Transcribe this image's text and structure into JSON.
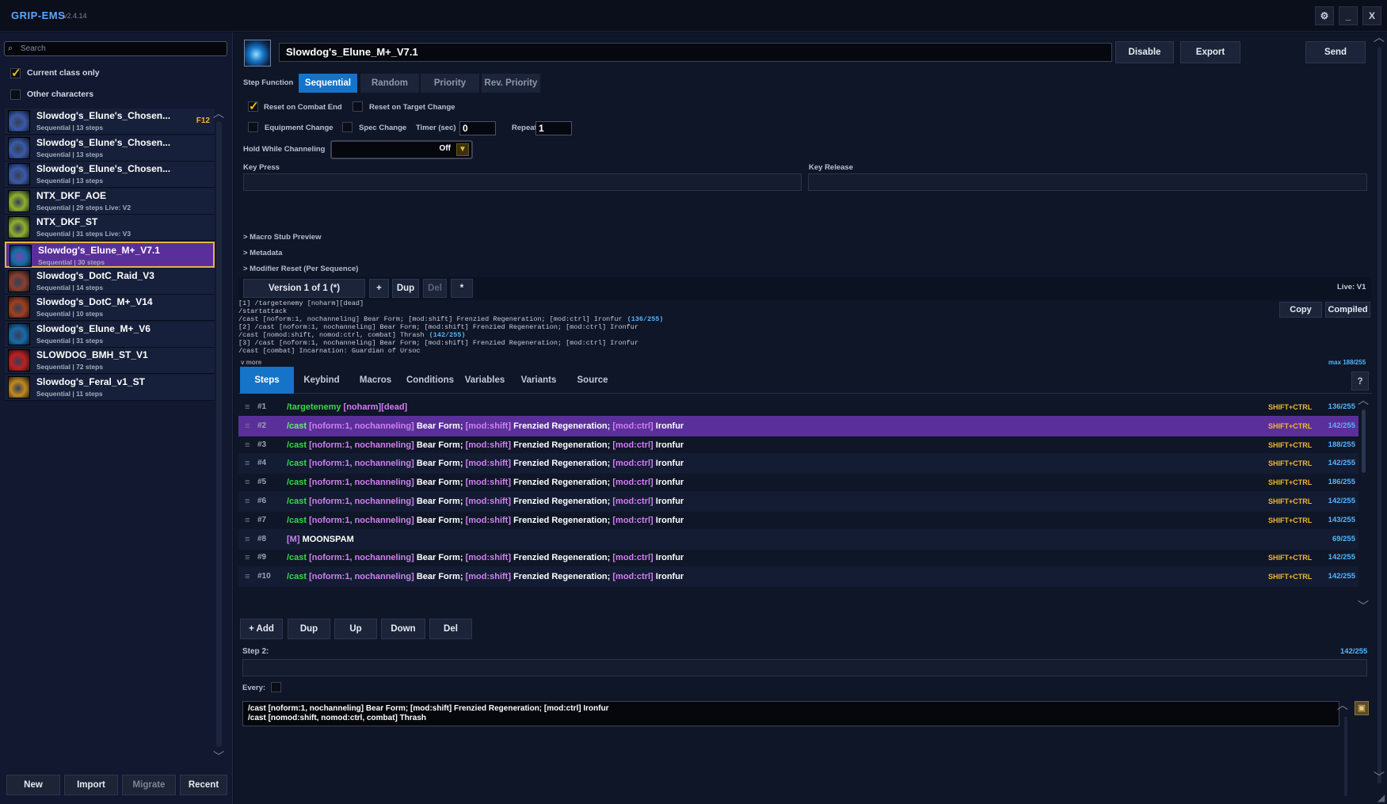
{
  "app": {
    "title": "GRIP-EMS",
    "version": "v2.4.14"
  },
  "window_buttons": {
    "settings_icon": "gear-icon",
    "minimize_label": "_",
    "close_label": "X"
  },
  "sidebar": {
    "search_placeholder": "Search",
    "current_class_only": {
      "label": "Current class only",
      "checked": true
    },
    "other_characters": {
      "label": "Other characters",
      "checked": false
    },
    "sequences": [
      {
        "name": "Slowdog's_Elune's_Chosen...",
        "sub": "Sequential | 13 steps",
        "key": "F12",
        "icon_color": "#3a5aa8",
        "selected": false
      },
      {
        "name": "Slowdog's_Elune's_Chosen...",
        "sub": "Sequential | 13 steps",
        "key": "",
        "icon_color": "#3a5aa8",
        "selected": false
      },
      {
        "name": "Slowdog's_Elune's_Chosen...",
        "sub": "Sequential | 13 steps",
        "key": "",
        "icon_color": "#3a5aa8",
        "selected": false
      },
      {
        "name": "NTX_DKF_AOE",
        "sub": "Sequential | 29 steps   Live: V2",
        "key": "",
        "icon_color": "#8fb030",
        "selected": false
      },
      {
        "name": "NTX_DKF_ST",
        "sub": "Sequential | 31 steps   Live: V3",
        "key": "",
        "icon_color": "#8fb030",
        "selected": false
      },
      {
        "name": "Slowdog's_Elune_M+_V7.1",
        "sub": "Sequential | 30 steps",
        "key": "",
        "icon_color": "#1a6aa8",
        "selected": true
      },
      {
        "name": "Slowdog's_DotC_Raid_V3",
        "sub": "Sequential | 14 steps",
        "key": "",
        "icon_color": "#8a4030",
        "selected": false
      },
      {
        "name": "Slowdog's_DotC_M+_V14",
        "sub": "Sequential | 10 steps",
        "key": "",
        "icon_color": "#a04020",
        "selected": false
      },
      {
        "name": "Slowdog's_Elune_M+_V6",
        "sub": "Sequential | 31 steps",
        "key": "",
        "icon_color": "#1a6aa8",
        "selected": false
      },
      {
        "name": "SLOWDOG_BMH_ST_V1",
        "sub": "Sequential | 72 steps",
        "key": "",
        "icon_color": "#c02020",
        "selected": false
      },
      {
        "name": "Slowdog's_Feral_v1_ST",
        "sub": "Sequential | 11 steps",
        "key": "",
        "icon_color": "#c08a20",
        "selected": false
      }
    ],
    "buttons": {
      "new": "New",
      "import": "Import",
      "migrate": "Migrate",
      "recent": "Recent"
    }
  },
  "editor": {
    "sequence_name": "Slowdog's_Elune_M+_V7.1",
    "disable": "Disable",
    "export": "Export",
    "send": "Send",
    "step_function_label": "Step Function",
    "step_functions": [
      "Sequential",
      "Random",
      "Priority",
      "Rev. Priority"
    ],
    "step_function_selected": "Sequential",
    "reset_on_combat_end": {
      "label": "Reset on Combat End",
      "checked": true
    },
    "reset_on_target_change": {
      "label": "Reset on Target Change",
      "checked": false
    },
    "equipment_change": {
      "label": "Equipment Change",
      "checked": false
    },
    "spec_change": {
      "label": "Spec Change",
      "checked": false
    },
    "timer_label": "Timer (sec)",
    "timer_value": "0",
    "repeat_label": "Repeat",
    "repeat_value": "1",
    "hold_while_channeling_label": "Hold While Channeling",
    "hold_while_channeling_value": "Off",
    "key_press_label": "Key Press",
    "key_release_label": "Key Release",
    "expanders": [
      "> Macro Stub Preview",
      "> Metadata",
      "> Modifier Reset (Per Sequence)"
    ],
    "version_label": "Version 1 of 1 (*)",
    "version_buttons": {
      "add": "+",
      "dup": "Dup",
      "del": "Del",
      "star": "*"
    },
    "live_label": "Live: V1",
    "copy": "Copy",
    "compiled": "Compiled",
    "macro_preview": [
      {
        "text": "[1] /targetenemy [noharm][dead]",
        "len": ""
      },
      {
        "text": "/startattack",
        "len": ""
      },
      {
        "text": "/cast [noform:1, nochanneling] Bear Form; [mod:shift] Frenzied Regeneration; [mod:ctrl] Ironfur",
        "len": "(136/255)"
      },
      {
        "text": "[2] /cast [noform:1, nochanneling] Bear Form; [mod:shift] Frenzied Regeneration; [mod:ctrl] Ironfur",
        "len": ""
      },
      {
        "text": "/cast [nomod:shift, nomod:ctrl, combat] Thrash",
        "len": "(142/255)"
      },
      {
        "text": "[3] /cast [noform:1, nochanneling] Bear Form; [mod:shift] Frenzied Regeneration; [mod:ctrl] Ironfur",
        "len": ""
      },
      {
        "text": "/cast [combat] Incarnation: Guardian of Ursoc",
        "len": ""
      }
    ],
    "more_label": "v more",
    "max_label": "max 188/255",
    "tabs": [
      "Steps",
      "Keybind",
      "Macros",
      "Conditions",
      "Variables",
      "Variants",
      "Source"
    ],
    "tab_selected": "Steps",
    "help": "?",
    "steps": [
      {
        "num": "#1",
        "cmd": "/targetenemy",
        "cond": "[noharm][dead]",
        "rest": [],
        "key": "SHIFT+CTRL",
        "count": "136/255"
      },
      {
        "num": "#2",
        "cmd": "/cast",
        "cond": "[noform:1, nochanneling]",
        "rest": [
          "Bear Form;",
          "[mod:shift]",
          "Frenzied Regeneration;",
          "[mod:ctrl]",
          "Ironfur"
        ],
        "key": "SHIFT+CTRL",
        "count": "142/255"
      },
      {
        "num": "#3",
        "cmd": "/cast",
        "cond": "[noform:1, nochanneling]",
        "rest": [
          "Bear Form;",
          "[mod:shift]",
          "Frenzied Regeneration;",
          "[mod:ctrl]",
          "Ironfur"
        ],
        "key": "SHIFT+CTRL",
        "count": "188/255"
      },
      {
        "num": "#4",
        "cmd": "/cast",
        "cond": "[noform:1, nochanneling]",
        "rest": [
          "Bear Form;",
          "[mod:shift]",
          "Frenzied Regeneration;",
          "[mod:ctrl]",
          "Ironfur"
        ],
        "key": "SHIFT+CTRL",
        "count": "142/255"
      },
      {
        "num": "#5",
        "cmd": "/cast",
        "cond": "[noform:1, nochanneling]",
        "rest": [
          "Bear Form;",
          "[mod:shift]",
          "Frenzied Regeneration;",
          "[mod:ctrl]",
          "Ironfur"
        ],
        "key": "SHIFT+CTRL",
        "count": "186/255"
      },
      {
        "num": "#6",
        "cmd": "/cast",
        "cond": "[noform:1, nochanneling]",
        "rest": [
          "Bear Form;",
          "[mod:shift]",
          "Frenzied Regeneration;",
          "[mod:ctrl]",
          "Ironfur"
        ],
        "key": "SHIFT+CTRL",
        "count": "142/255"
      },
      {
        "num": "#7",
        "cmd": "/cast",
        "cond": "[noform:1, nochanneling]",
        "rest": [
          "Bear Form;",
          "[mod:shift]",
          "Frenzied Regeneration;",
          "[mod:ctrl]",
          "Ironfur"
        ],
        "key": "SHIFT+CTRL",
        "count": "143/255"
      },
      {
        "num": "#8",
        "cmd": "",
        "cond": "[M]",
        "rest": [
          "MOONSPAM"
        ],
        "key": "",
        "count": "69/255"
      },
      {
        "num": "#9",
        "cmd": "/cast",
        "cond": "[noform:1, nochanneling]",
        "rest": [
          "Bear Form;",
          "[mod:shift]",
          "Frenzied Regeneration;",
          "[mod:ctrl]",
          "Ironfur"
        ],
        "key": "SHIFT+CTRL",
        "count": "142/255"
      },
      {
        "num": "#10",
        "cmd": "/cast",
        "cond": "[noform:1, nochanneling]",
        "rest": [
          "Bear Form;",
          "[mod:shift]",
          "Frenzied Regeneration;",
          "[mod:ctrl]",
          "Ironfur"
        ],
        "key": "SHIFT+CTRL",
        "count": "142/255"
      }
    ],
    "selected_step": 1,
    "step_buttons": {
      "add": "+ Add",
      "dup": "Dup",
      "up": "Up",
      "down": "Down",
      "del": "Del"
    },
    "step_label": "Step 2:",
    "step_count": "142/255",
    "every_label": "Every:",
    "step_text": [
      "/cast [noform:1, nochanneling] Bear Form; [mod:shift] Frenzied Regeneration; [mod:ctrl] Ironfur",
      "/cast [nomod:shift, nomod:ctrl, combat] Thrash"
    ]
  }
}
